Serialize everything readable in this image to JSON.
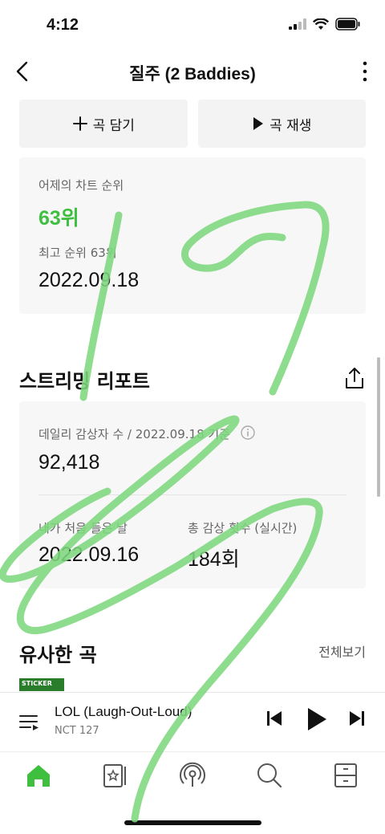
{
  "status": {
    "time": "4:12"
  },
  "nav": {
    "title": "질주 (2 Baddies)"
  },
  "actions": {
    "add_label": "곡 담기",
    "play_label": "곡 재생"
  },
  "chart": {
    "yesterday_label": "어제의 차트 순위",
    "yesterday_rank": "63위",
    "best_label": "최고 순위 63위",
    "best_date": "2022.09.18"
  },
  "report": {
    "title": "스트리밍 리포트",
    "daily_label": "데일리 감상자 수 / 2022.09.18 기준",
    "daily_value": "92,418",
    "first_label": "내가 처음 들은 날",
    "first_value": "2022.09.16",
    "total_label": "총 감상 횟수 (실시간)",
    "total_value": "184회"
  },
  "similar": {
    "title": "유사한 곡",
    "see_all": "전체보기",
    "thumb_text": "STICKER"
  },
  "player": {
    "title": "LOL (Laugh-Out-Loud)",
    "artist": "NCT 127"
  },
  "colors": {
    "accent": "#3fbf3f",
    "scribble": "#7ed77e"
  },
  "icons": [
    "back-icon",
    "more-icon",
    "plus-icon",
    "play-icon",
    "share-icon",
    "info-icon",
    "playlist-icon",
    "previous-icon",
    "next-icon",
    "home-icon",
    "library-icon",
    "podcast-icon",
    "search-icon",
    "drawer-icon"
  ]
}
